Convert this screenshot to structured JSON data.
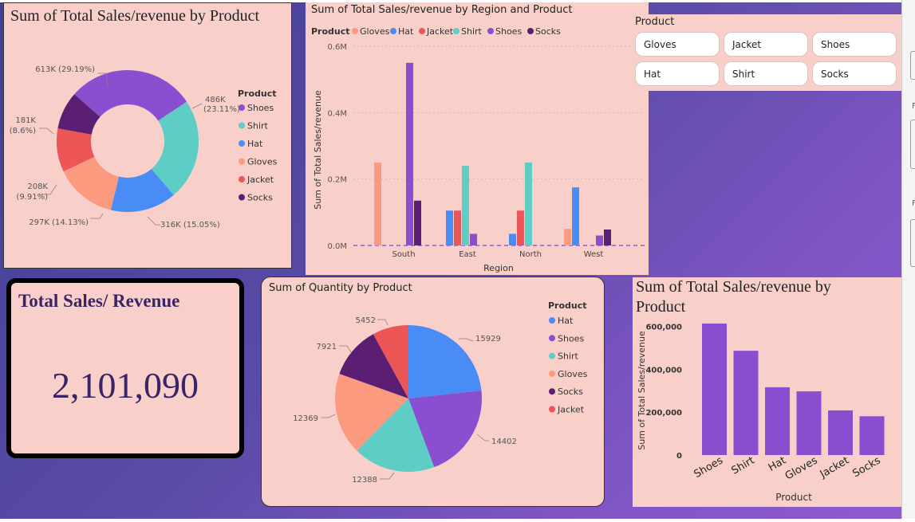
{
  "colors": {
    "shoes": "#8a4fd0",
    "shirt": "#5ecdc6",
    "hat": "#4a8cf6",
    "gloves": "#fc9a80",
    "jacket": "#ec5656",
    "socks": "#5a1f72"
  },
  "donut": {
    "title": "Sum of Total Sales/revenue by Product",
    "legend_title": "Product",
    "legend": [
      "Shoes",
      "Shirt",
      "Hat",
      "Gloves",
      "Jacket",
      "Socks"
    ],
    "labels": {
      "shoes": "613K (29.19%)",
      "shirt_1": "486K",
      "shirt_2": "(23.11%)",
      "hat": "316K (15.05%)",
      "gloves": "297K (14.13%)",
      "jacket_1": "208K",
      "jacket_2": "(9.91%)",
      "socks_1": "181K",
      "socks_2": "(8.6%)"
    }
  },
  "cluster": {
    "title": "Sum of Total Sales/revenue by Region and Product",
    "legend_title": "Product",
    "legend": [
      "Gloves",
      "Hat",
      "Jacket",
      "Shirt",
      "Shoes",
      "Socks"
    ],
    "ylabel": "Sum of Total Sales/revenue",
    "xlabel": "Region",
    "yticks": [
      "0.0M",
      "0.2M",
      "0.4M",
      "0.6M"
    ],
    "regions": [
      "South",
      "East",
      "North",
      "West"
    ]
  },
  "slicer": {
    "title": "Product",
    "items": [
      "Gloves",
      "Jacket",
      "Shoes",
      "Hat",
      "Shirt",
      "Socks"
    ]
  },
  "kpi": {
    "title": "Total Sales/ Revenue",
    "value": "2,101,090"
  },
  "pie": {
    "title": "Sum of Quantity by Product",
    "legend_title": "Product",
    "legend": [
      "Hat",
      "Shoes",
      "Shirt",
      "Gloves",
      "Socks",
      "Jacket"
    ],
    "labels": {
      "hat": "15929",
      "shoes": "14402",
      "shirt": "12388",
      "gloves": "12369",
      "socks": "7921",
      "jacket": "5452"
    }
  },
  "bar": {
    "title_1": "Sum of Total Sales/revenue by",
    "title_2": "Product",
    "ylabel": "Sum of Total Sales/revenue",
    "xlabel": "Product",
    "yticks": [
      "0",
      "200,000",
      "400,000",
      "600,000"
    ]
  },
  "chart_data": [
    {
      "type": "pie",
      "title": "Sum of Total Sales/revenue by Product",
      "categories": [
        "Shoes",
        "Shirt",
        "Hat",
        "Gloves",
        "Jacket",
        "Socks"
      ],
      "values": [
        613000,
        486000,
        316000,
        297000,
        208000,
        181000
      ],
      "percents": [
        29.19,
        23.11,
        15.05,
        14.13,
        9.91,
        8.6
      ],
      "legend": "right"
    },
    {
      "type": "bar",
      "title": "Sum of Total Sales/revenue by Region and Product",
      "categories": [
        "South",
        "East",
        "North",
        "West"
      ],
      "xlabel": "Region",
      "ylabel": "Sum of Total Sales/revenue",
      "ylim": [
        0,
        0.6
      ],
      "series": [
        {
          "name": "Gloves",
          "values": [
            0.25,
            0,
            0,
            0.05
          ]
        },
        {
          "name": "Hat",
          "values": [
            0,
            0.105,
            0.035,
            0.175
          ]
        },
        {
          "name": "Jacket",
          "values": [
            0,
            0.105,
            0.105,
            0
          ]
        },
        {
          "name": "Shirt",
          "values": [
            0,
            0.24,
            0.25,
            0
          ]
        },
        {
          "name": "Shoes",
          "values": [
            0.55,
            0.035,
            0,
            0.03
          ]
        },
        {
          "name": "Socks",
          "values": [
            0.135,
            0,
            0,
            0.048
          ]
        }
      ],
      "legend": "top-left"
    },
    {
      "type": "pie",
      "title": "Sum of Quantity by Product",
      "categories": [
        "Hat",
        "Shoes",
        "Shirt",
        "Gloves",
        "Socks",
        "Jacket"
      ],
      "values": [
        15929,
        14402,
        12388,
        12369,
        7921,
        5452
      ],
      "legend": "right"
    },
    {
      "type": "bar",
      "title": "Sum of Total Sales/revenue by Product",
      "categories": [
        "Shoes",
        "Shirt",
        "Hat",
        "Gloves",
        "Jacket",
        "Socks"
      ],
      "values": [
        613000,
        486000,
        316000,
        297000,
        208000,
        181000
      ],
      "xlabel": "Product",
      "ylabel": "Sum of Total Sales/revenue",
      "ylim": [
        0,
        650000
      ]
    }
  ]
}
